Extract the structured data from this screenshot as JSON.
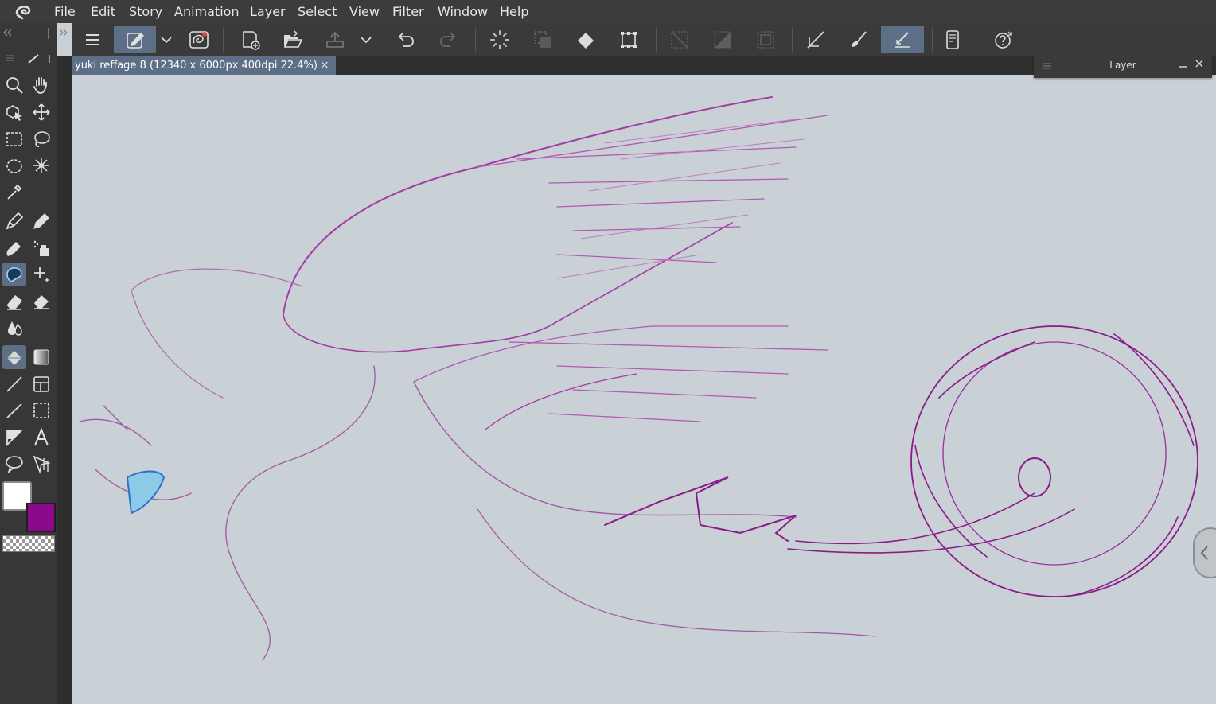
{
  "menu": [
    "File",
    "Edit",
    "Story",
    "Animation",
    "Layer",
    "Select",
    "View",
    "Filter",
    "Window",
    "Help"
  ],
  "document": {
    "tab_title": "yuki reffage 8 (12340 x 6000px 400dpi 22.4%)",
    "close_symbol": "×"
  },
  "layer_panel": {
    "title": "Layer"
  },
  "commands": [
    "menu-icon",
    "sub-tool-detail-icon",
    "dropdown-icon",
    "lasso-fill-icon",
    "new-canvas-icon",
    "open-folder-icon",
    "save-icon",
    "dropdown-icon",
    "undo-icon",
    "redo-icon",
    "spinner-icon",
    "clear-selection-icon",
    "fill-icon",
    "transform-icon",
    "hide-selection-icon",
    "invert-selection-icon",
    "select-all-icon",
    "ruler-icon",
    "brush-icon",
    "pen-pressure-icon",
    "device-icon",
    "help-icon"
  ],
  "tools": [
    "zoom-icon",
    "hand-icon",
    "object-icon",
    "move-icon",
    "rect-select-icon",
    "lasso-select-icon",
    "shrink-select-icon",
    "magic-wand-icon",
    "eyedropper-icon",
    "pen-icon",
    "pencil-icon",
    "brush-icon",
    "spray-icon",
    "blend-icon",
    "star-icon",
    "eraser-icon",
    "eraser-soft-icon",
    "water-icon",
    "fill-bucket-icon",
    "gradient-icon",
    "line-icon",
    "frame-icon",
    "straight-line-icon",
    "dotted-rect-icon",
    "ruler-triangle-icon",
    "text-icon",
    "balloon-icon",
    "correct-line-icon"
  ],
  "colors": {
    "main": "#ffffff",
    "sub": "#8b0a8b",
    "transparent_swatch": "checker",
    "accent": "#5d6f86",
    "sketch": "#9b2f9b"
  }
}
